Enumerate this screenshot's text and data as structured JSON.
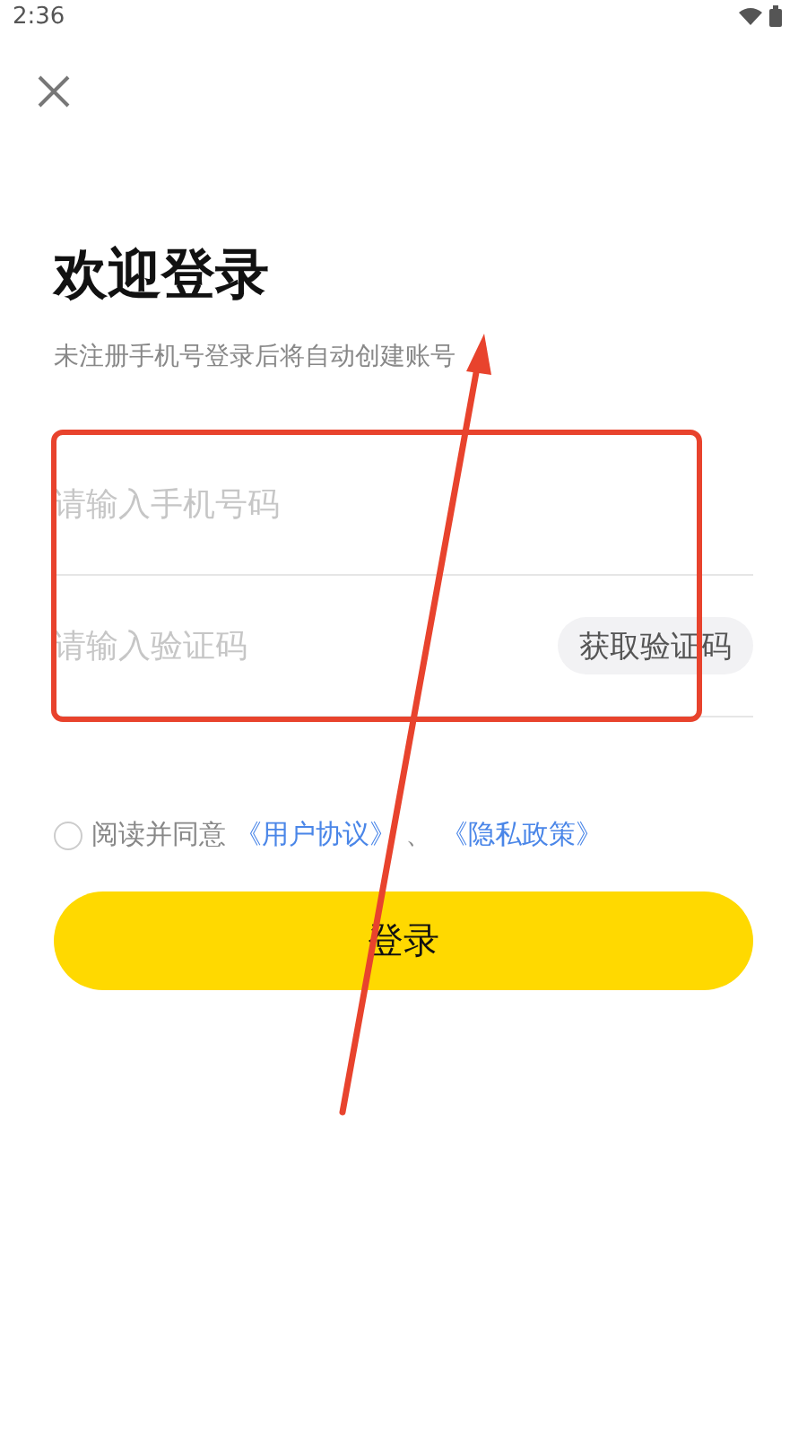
{
  "status_bar": {
    "time": "2:36"
  },
  "title": "欢迎登录",
  "subtitle": "未注册手机号登录后将自动创建账号",
  "phone_field": {
    "placeholder": "请输入手机号码"
  },
  "code_field": {
    "placeholder": "请输入验证码",
    "button": "获取验证码"
  },
  "agreement": {
    "checked": false,
    "text": "阅读并同意",
    "links": [
      "《用户协议》",
      "《隐私政策》"
    ],
    "separator": "、"
  },
  "login_button": "登录"
}
